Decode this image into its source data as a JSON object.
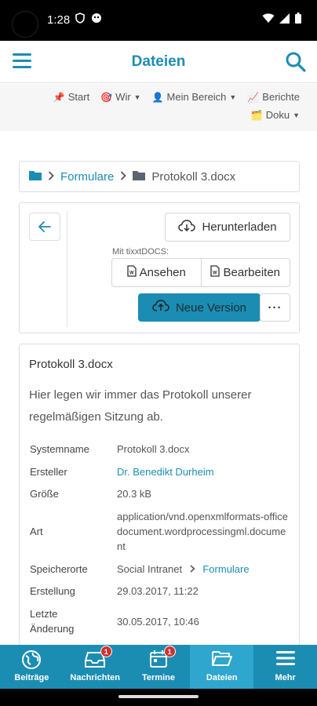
{
  "status_bar": {
    "time": "1:28"
  },
  "header": {
    "title": "Dateien"
  },
  "nav": {
    "items": [
      {
        "label": "Start",
        "emoji": "📌"
      },
      {
        "label": "Wir",
        "emoji": "🎯"
      },
      {
        "label": "Mein Bereich",
        "emoji": "👤"
      },
      {
        "label": "Berichte",
        "emoji": "📈"
      },
      {
        "label": "Doku",
        "emoji": "🗂️"
      }
    ]
  },
  "breadcrumb": {
    "parent": "Formulare",
    "current": "Protokoll 3.docx"
  },
  "actions": {
    "download_label": "Herunterladen",
    "mit_label": "Mit tixxtDOCS:",
    "view_label": "Ansehen",
    "edit_label": "Bearbeiten",
    "new_version_label": "Neue Version",
    "more_label": "···"
  },
  "document": {
    "title": "Protokoll 3.docx",
    "description": "Hier legen wir immer das Protokoll unserer regelmäßigen Sitzung ab.",
    "meta": {
      "systemname_label": "Systemname",
      "systemname": "Protokoll 3.docx",
      "ersteller_label": "Ersteller",
      "ersteller": "Dr. Benedikt Durheim",
      "groesse_label": "Größe",
      "groesse": "20.3 kB",
      "art_label": "Art",
      "art": "application/vnd.openxmlformats-officedocument.wordprocessingml.document",
      "speicherorte_label": "Speicherorte",
      "speicherort_root": "Social Intranet",
      "speicherort_folder": "Formulare",
      "erstellung_label": "Erstellung",
      "erstellung": "29.03.2017, 11:22",
      "aenderung_label": "Letzte Änderung",
      "aenderung": "30.05.2017, 10:46"
    }
  },
  "bottom_nav": {
    "items": [
      {
        "label": "Beiträge",
        "badge": ""
      },
      {
        "label": "Nachrichten",
        "badge": "1"
      },
      {
        "label": "Termine",
        "badge": "1"
      },
      {
        "label": "Dateien",
        "badge": ""
      },
      {
        "label": "Mehr",
        "badge": ""
      }
    ]
  },
  "colors": {
    "accent": "#1b8db3",
    "active_tab": "#2ea6cd",
    "badge": "#d32f2f"
  }
}
